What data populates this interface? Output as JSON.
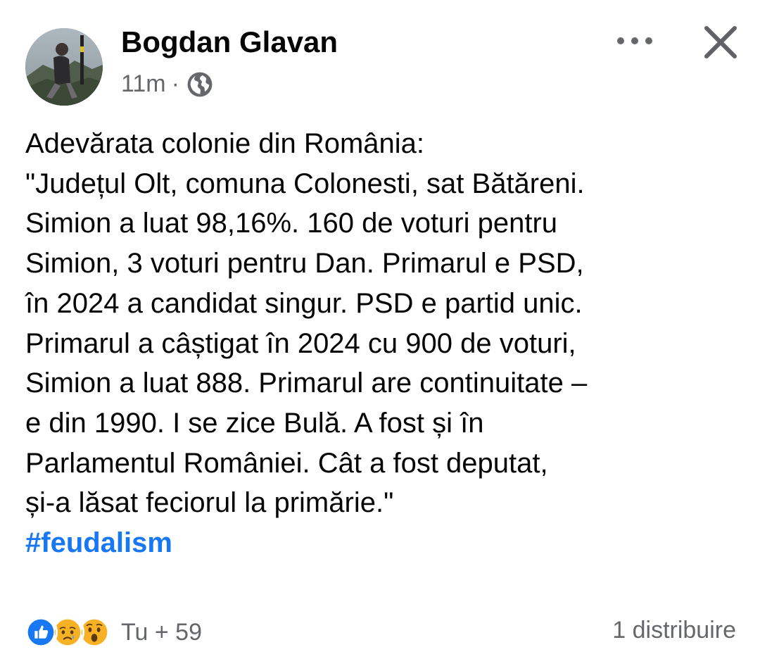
{
  "post": {
    "author": "Bogdan Glavan",
    "time": "11m",
    "separator": "·",
    "privacy_icon": "globe-icon",
    "text_lines": [
      "Adevărata colonie din România:",
      "\"Județul Olt, comuna Colonesti, sat Bătăreni.",
      "Simion a luat 98,16%. 160 de voturi pentru",
      "Simion, 3 voturi pentru Dan. Primarul e PSD,",
      "în 2024 a candidat singur. PSD e partid unic.",
      "Primarul a câștigat în 2024 cu 900 de voturi,",
      "Simion a luat 888. Primarul are continuitate –",
      "e din 1990. I se zice Bulă. A fost și în",
      "Parlamentul României. Cât a fost deputat,",
      "și-a lăsat feciorul la primărie.\""
    ],
    "hashtag": "#feudalism"
  },
  "header_actions": {
    "more_icon": "more-horizontal-icon",
    "close_icon": "close-icon"
  },
  "footer": {
    "reaction_icons": [
      "like-icon",
      "sad-icon",
      "wow-icon"
    ],
    "reactions_text": "Tu + 59",
    "shares_text": "1 distribuire"
  },
  "colors": {
    "text": "#050505",
    "secondary": "#65676b",
    "link": "#1877f2",
    "like": "#1877f2",
    "reaction_yellow": "#f7b125"
  }
}
